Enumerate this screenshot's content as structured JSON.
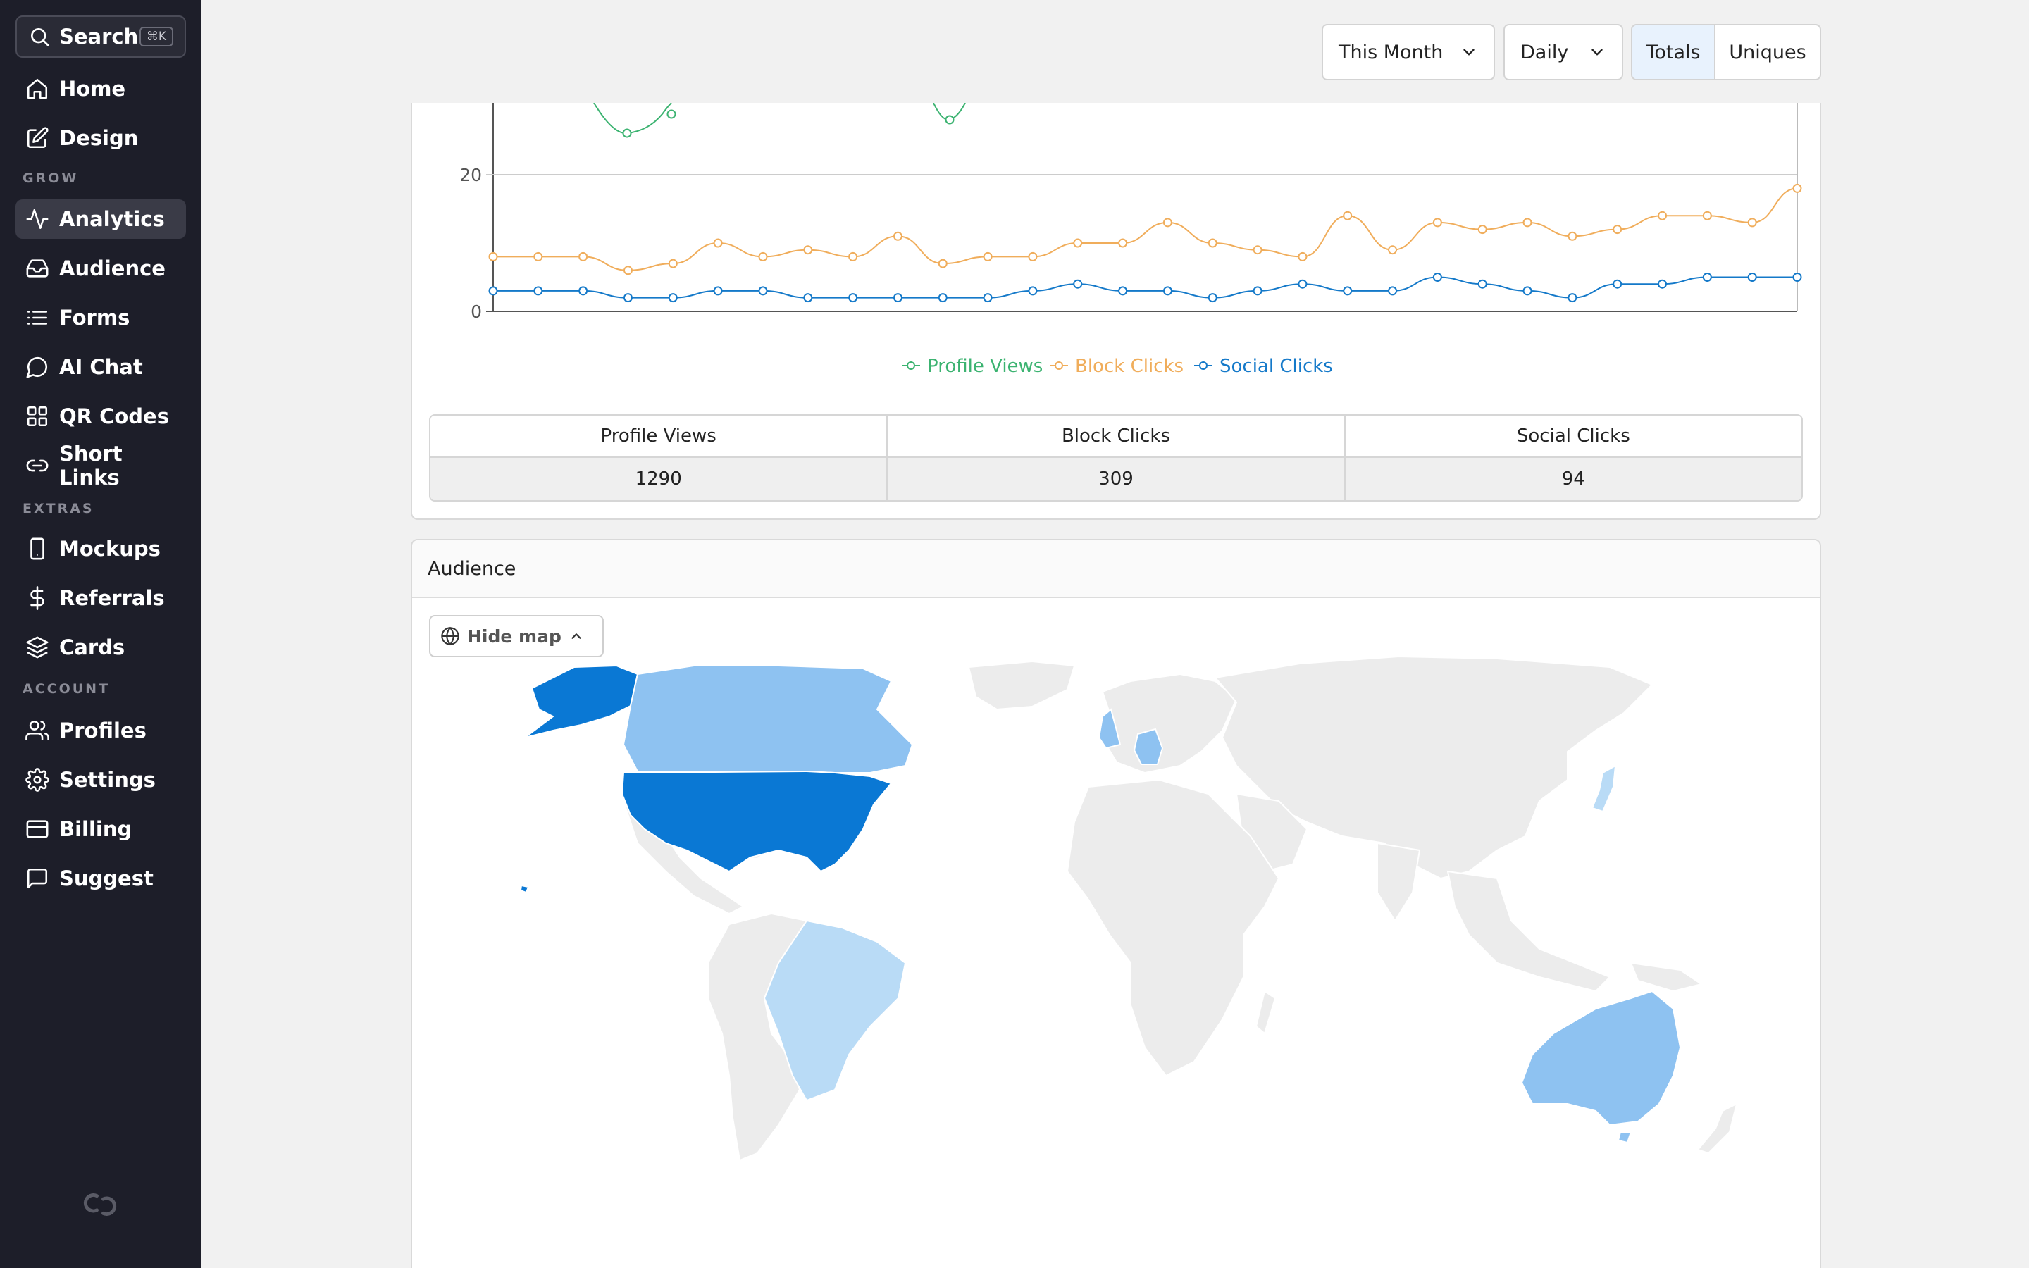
{
  "sidebar": {
    "search": {
      "label": "Search",
      "shortcut": "⌘K"
    },
    "items_top": [
      {
        "label": "Home",
        "icon": "home-icon"
      },
      {
        "label": "Design",
        "icon": "edit-icon"
      }
    ],
    "section_grow": "GROW",
    "items_grow": [
      {
        "label": "Analytics",
        "icon": "activity-icon",
        "active": true
      },
      {
        "label": "Audience",
        "icon": "inbox-icon"
      },
      {
        "label": "Forms",
        "icon": "list-icon"
      },
      {
        "label": "AI Chat",
        "icon": "chat-icon"
      },
      {
        "label": "QR Codes",
        "icon": "grid-icon"
      },
      {
        "label": "Short Links",
        "icon": "link-icon"
      }
    ],
    "section_extras": "EXTRAS",
    "items_extras": [
      {
        "label": "Mockups",
        "icon": "phone-icon"
      },
      {
        "label": "Referrals",
        "icon": "dollar-icon"
      },
      {
        "label": "Cards",
        "icon": "layers-icon"
      }
    ],
    "section_account": "ACCOUNT",
    "items_account": [
      {
        "label": "Profiles",
        "icon": "users-icon"
      },
      {
        "label": "Settings",
        "icon": "gear-icon"
      },
      {
        "label": "Billing",
        "icon": "credit-card-icon"
      },
      {
        "label": "Suggest",
        "icon": "message-icon"
      }
    ]
  },
  "controls": {
    "range": "This Month",
    "interval": "Daily",
    "mode_totals": "Totals",
    "mode_uniques": "Uniques",
    "active_mode": "Totals"
  },
  "chart_data": {
    "type": "line",
    "ytick_labels": [
      "0",
      "20"
    ],
    "visible_ylim": [
      0,
      20
    ],
    "points_per_series": 30,
    "series": [
      {
        "name": "Block Clicks",
        "color": "#f0ad5b",
        "values": [
          8,
          8,
          8,
          6,
          7,
          10,
          8,
          9,
          8,
          11,
          7,
          8,
          8,
          10,
          10,
          13,
          10,
          9,
          8,
          14,
          9,
          13,
          12,
          13,
          11,
          12,
          14,
          14,
          13,
          18
        ]
      },
      {
        "name": "Social Clicks",
        "color": "#1479c9",
        "values": [
          3,
          3,
          3,
          2,
          2,
          3,
          3,
          2,
          2,
          2,
          2,
          2,
          3,
          4,
          3,
          3,
          2,
          3,
          4,
          3,
          3,
          5,
          4,
          3,
          2,
          4,
          4,
          5,
          5,
          5
        ]
      }
    ],
    "legend": [
      "Profile Views",
      "Block Clicks",
      "Social Clicks"
    ],
    "legend_colors": [
      "#3cb371",
      "#f0ad5b",
      "#1479c9"
    ],
    "legend_position": "bottom"
  },
  "stats": {
    "headers": [
      "Profile Views",
      "Block Clicks",
      "Social Clicks"
    ],
    "values": [
      "1290",
      "309",
      "94"
    ]
  },
  "audience": {
    "title": "Audience",
    "hide_map_label": "Hide map",
    "map_colors": {
      "high": "#0a78d4",
      "mid": "#8ec2f1",
      "low": "#b9dbf6",
      "none": "#ececec"
    }
  }
}
